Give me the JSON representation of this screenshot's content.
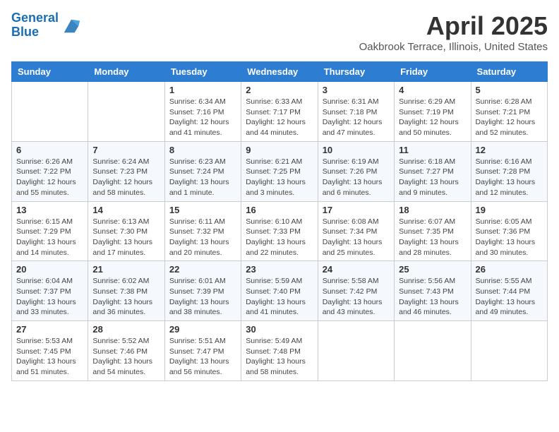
{
  "header": {
    "logo_line1": "General",
    "logo_line2": "Blue",
    "title": "April 2025",
    "subtitle": "Oakbrook Terrace, Illinois, United States"
  },
  "weekdays": [
    "Sunday",
    "Monday",
    "Tuesday",
    "Wednesday",
    "Thursday",
    "Friday",
    "Saturday"
  ],
  "weeks": [
    [
      {
        "day": "",
        "sunrise": "",
        "sunset": "",
        "daylight": ""
      },
      {
        "day": "",
        "sunrise": "",
        "sunset": "",
        "daylight": ""
      },
      {
        "day": "1",
        "sunrise": "Sunrise: 6:34 AM",
        "sunset": "Sunset: 7:16 PM",
        "daylight": "Daylight: 12 hours and 41 minutes."
      },
      {
        "day": "2",
        "sunrise": "Sunrise: 6:33 AM",
        "sunset": "Sunset: 7:17 PM",
        "daylight": "Daylight: 12 hours and 44 minutes."
      },
      {
        "day": "3",
        "sunrise": "Sunrise: 6:31 AM",
        "sunset": "Sunset: 7:18 PM",
        "daylight": "Daylight: 12 hours and 47 minutes."
      },
      {
        "day": "4",
        "sunrise": "Sunrise: 6:29 AM",
        "sunset": "Sunset: 7:19 PM",
        "daylight": "Daylight: 12 hours and 50 minutes."
      },
      {
        "day": "5",
        "sunrise": "Sunrise: 6:28 AM",
        "sunset": "Sunset: 7:21 PM",
        "daylight": "Daylight: 12 hours and 52 minutes."
      }
    ],
    [
      {
        "day": "6",
        "sunrise": "Sunrise: 6:26 AM",
        "sunset": "Sunset: 7:22 PM",
        "daylight": "Daylight: 12 hours and 55 minutes."
      },
      {
        "day": "7",
        "sunrise": "Sunrise: 6:24 AM",
        "sunset": "Sunset: 7:23 PM",
        "daylight": "Daylight: 12 hours and 58 minutes."
      },
      {
        "day": "8",
        "sunrise": "Sunrise: 6:23 AM",
        "sunset": "Sunset: 7:24 PM",
        "daylight": "Daylight: 13 hours and 1 minute."
      },
      {
        "day": "9",
        "sunrise": "Sunrise: 6:21 AM",
        "sunset": "Sunset: 7:25 PM",
        "daylight": "Daylight: 13 hours and 3 minutes."
      },
      {
        "day": "10",
        "sunrise": "Sunrise: 6:19 AM",
        "sunset": "Sunset: 7:26 PM",
        "daylight": "Daylight: 13 hours and 6 minutes."
      },
      {
        "day": "11",
        "sunrise": "Sunrise: 6:18 AM",
        "sunset": "Sunset: 7:27 PM",
        "daylight": "Daylight: 13 hours and 9 minutes."
      },
      {
        "day": "12",
        "sunrise": "Sunrise: 6:16 AM",
        "sunset": "Sunset: 7:28 PM",
        "daylight": "Daylight: 13 hours and 12 minutes."
      }
    ],
    [
      {
        "day": "13",
        "sunrise": "Sunrise: 6:15 AM",
        "sunset": "Sunset: 7:29 PM",
        "daylight": "Daylight: 13 hours and 14 minutes."
      },
      {
        "day": "14",
        "sunrise": "Sunrise: 6:13 AM",
        "sunset": "Sunset: 7:30 PM",
        "daylight": "Daylight: 13 hours and 17 minutes."
      },
      {
        "day": "15",
        "sunrise": "Sunrise: 6:11 AM",
        "sunset": "Sunset: 7:32 PM",
        "daylight": "Daylight: 13 hours and 20 minutes."
      },
      {
        "day": "16",
        "sunrise": "Sunrise: 6:10 AM",
        "sunset": "Sunset: 7:33 PM",
        "daylight": "Daylight: 13 hours and 22 minutes."
      },
      {
        "day": "17",
        "sunrise": "Sunrise: 6:08 AM",
        "sunset": "Sunset: 7:34 PM",
        "daylight": "Daylight: 13 hours and 25 minutes."
      },
      {
        "day": "18",
        "sunrise": "Sunrise: 6:07 AM",
        "sunset": "Sunset: 7:35 PM",
        "daylight": "Daylight: 13 hours and 28 minutes."
      },
      {
        "day": "19",
        "sunrise": "Sunrise: 6:05 AM",
        "sunset": "Sunset: 7:36 PM",
        "daylight": "Daylight: 13 hours and 30 minutes."
      }
    ],
    [
      {
        "day": "20",
        "sunrise": "Sunrise: 6:04 AM",
        "sunset": "Sunset: 7:37 PM",
        "daylight": "Daylight: 13 hours and 33 minutes."
      },
      {
        "day": "21",
        "sunrise": "Sunrise: 6:02 AM",
        "sunset": "Sunset: 7:38 PM",
        "daylight": "Daylight: 13 hours and 36 minutes."
      },
      {
        "day": "22",
        "sunrise": "Sunrise: 6:01 AM",
        "sunset": "Sunset: 7:39 PM",
        "daylight": "Daylight: 13 hours and 38 minutes."
      },
      {
        "day": "23",
        "sunrise": "Sunrise: 5:59 AM",
        "sunset": "Sunset: 7:40 PM",
        "daylight": "Daylight: 13 hours and 41 minutes."
      },
      {
        "day": "24",
        "sunrise": "Sunrise: 5:58 AM",
        "sunset": "Sunset: 7:42 PM",
        "daylight": "Daylight: 13 hours and 43 minutes."
      },
      {
        "day": "25",
        "sunrise": "Sunrise: 5:56 AM",
        "sunset": "Sunset: 7:43 PM",
        "daylight": "Daylight: 13 hours and 46 minutes."
      },
      {
        "day": "26",
        "sunrise": "Sunrise: 5:55 AM",
        "sunset": "Sunset: 7:44 PM",
        "daylight": "Daylight: 13 hours and 49 minutes."
      }
    ],
    [
      {
        "day": "27",
        "sunrise": "Sunrise: 5:53 AM",
        "sunset": "Sunset: 7:45 PM",
        "daylight": "Daylight: 13 hours and 51 minutes."
      },
      {
        "day": "28",
        "sunrise": "Sunrise: 5:52 AM",
        "sunset": "Sunset: 7:46 PM",
        "daylight": "Daylight: 13 hours and 54 minutes."
      },
      {
        "day": "29",
        "sunrise": "Sunrise: 5:51 AM",
        "sunset": "Sunset: 7:47 PM",
        "daylight": "Daylight: 13 hours and 56 minutes."
      },
      {
        "day": "30",
        "sunrise": "Sunrise: 5:49 AM",
        "sunset": "Sunset: 7:48 PM",
        "daylight": "Daylight: 13 hours and 58 minutes."
      },
      {
        "day": "",
        "sunrise": "",
        "sunset": "",
        "daylight": ""
      },
      {
        "day": "",
        "sunrise": "",
        "sunset": "",
        "daylight": ""
      },
      {
        "day": "",
        "sunrise": "",
        "sunset": "",
        "daylight": ""
      }
    ]
  ]
}
